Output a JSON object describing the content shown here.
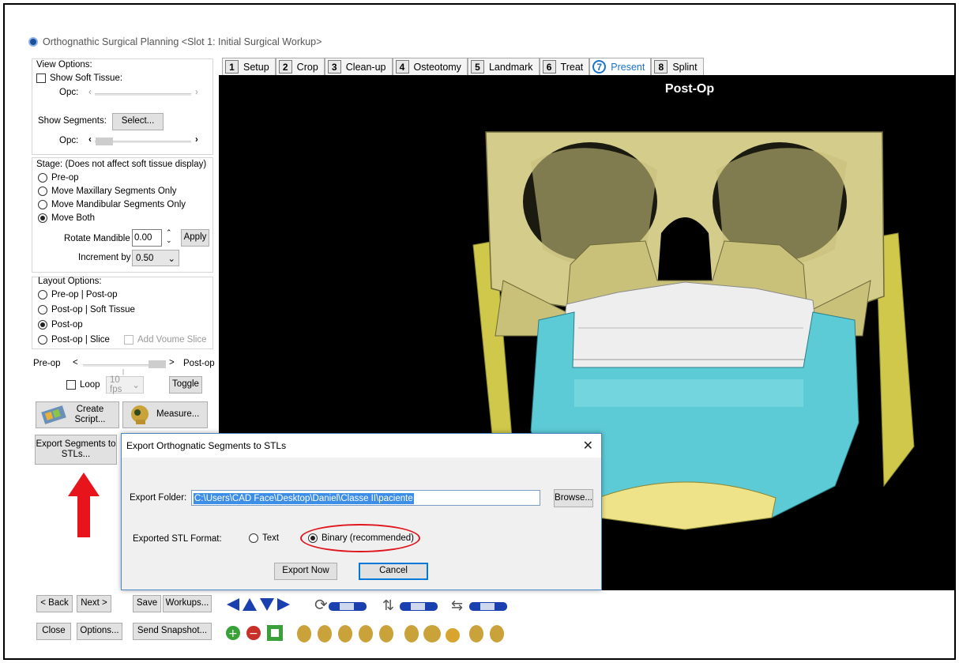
{
  "window": {
    "title": "Orthognathic Surgical Planning <Slot 1: Initial Surgical Workup>"
  },
  "view_options": {
    "header": "View Options:",
    "show_soft_tissue": "Show Soft Tissue:",
    "opc_label": "Opc:",
    "show_segments": "Show Segments:",
    "select_button": "Select...",
    "opc2_label": "Opc:"
  },
  "stage": {
    "header": "Stage: (Does not affect soft tissue display)",
    "options": [
      "Pre-op",
      "Move Maxillary Segments Only",
      "Move Mandibular Segments Only",
      "Move Both"
    ],
    "selected": "Move Both",
    "rotate_label": "Rotate Mandible",
    "rotate_value": "0.00",
    "apply_button": "Apply",
    "increment_label": "Increment by",
    "increment_value": "0.50"
  },
  "layout": {
    "header": "Layout Options:",
    "options": [
      "Pre-op | Post-op",
      "Post-op | Soft Tissue",
      "Post-op",
      "Post-op | Slice"
    ],
    "selected": "Post-op",
    "add_volume_slice": "Add Voume Slice"
  },
  "playback": {
    "pre_label": "Pre-op",
    "left_arrow": "<",
    "right_arrow": ">",
    "post_label": "Post-op",
    "loop_label": "Loop",
    "fps_value": "10 fps",
    "toggle_button": "Toggle"
  },
  "actions": {
    "create_script": "Create Script...",
    "measure": "Measure...",
    "export_segments": "Export Segments to STLs..."
  },
  "bottom_buttons": {
    "back": "< Back",
    "next": "Next >",
    "save": "Save",
    "workups": "Workups...",
    "close": "Close",
    "options": "Options...",
    "send_snapshot": "Send Snapshot..."
  },
  "tabs": [
    {
      "num": "1",
      "label": "Setup"
    },
    {
      "num": "2",
      "label": "Crop"
    },
    {
      "num": "3",
      "label": "Clean-up"
    },
    {
      "num": "4",
      "label": "Osteotomy"
    },
    {
      "num": "5",
      "label": "Landmark"
    },
    {
      "num": "6",
      "label": "Treat"
    },
    {
      "num": "7",
      "label": "Present"
    },
    {
      "num": "8",
      "label": "Splint"
    }
  ],
  "active_tab": "Present",
  "viewport": {
    "title": "Post-Op"
  },
  "dialog": {
    "title": "Export Orthognatic Segments to STLs",
    "close": "✕",
    "folder_label": "Export Folder:",
    "folder_value": "C:\\Users\\CAD Face\\Desktop\\Daniel\\Classe II\\paciente",
    "browse_button": "Browse...",
    "format_label": "Exported STL Format:",
    "format_options": [
      "Text",
      "Binary (recommended)"
    ],
    "format_selected": "Binary (recommended)",
    "export_now_button": "Export Now",
    "cancel_button": "Cancel"
  },
  "colors": {
    "bone": "#d4cc8a",
    "teeth": "#eeeeee",
    "mandible_segment": "#5dcbd6",
    "chin": "#efe38a",
    "annotation_red": "#e0161e",
    "accent_blue": "#1a73c8"
  }
}
